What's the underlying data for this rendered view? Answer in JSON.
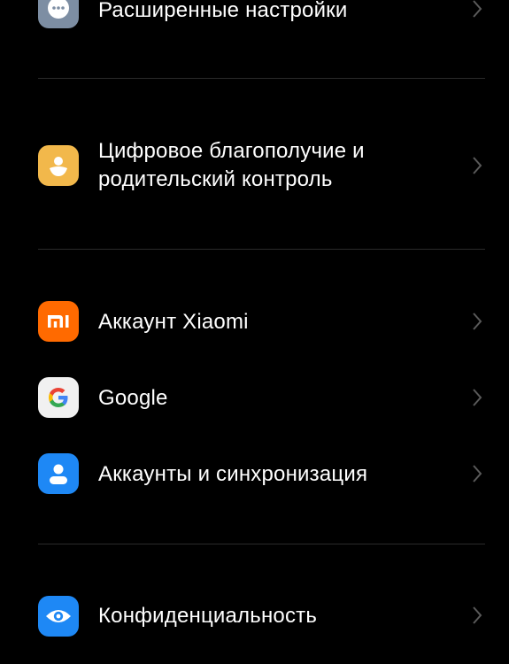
{
  "settings": {
    "items": [
      {
        "id": "advanced",
        "label": "Расширенные настройки",
        "icon": "more-dots-icon",
        "icon_color": "#7d8ea3"
      },
      {
        "id": "wellbeing",
        "label_line1": "Цифровое благополучие и",
        "label_line2": "родительский контроль",
        "icon": "wellbeing-person-icon",
        "icon_color": "#f2b84b"
      },
      {
        "id": "xiaomi",
        "label": "Аккаунт Xiaomi",
        "icon": "mi-logo-icon",
        "icon_color": "#ff6a00"
      },
      {
        "id": "google",
        "label": "Google",
        "icon": "google-g-icon",
        "icon_color": "#f1f1f1"
      },
      {
        "id": "accounts",
        "label": "Аккаунты и синхронизация",
        "icon": "account-person-icon",
        "icon_color": "#1e88f5"
      },
      {
        "id": "privacy",
        "label": "Конфиденциальность",
        "icon": "eye-icon",
        "icon_color": "#1e88f5"
      }
    ]
  },
  "colors": {
    "background": "#000000",
    "text": "#ffffff",
    "divider": "#2a2a2a",
    "chevron": "#5a5a5a"
  }
}
